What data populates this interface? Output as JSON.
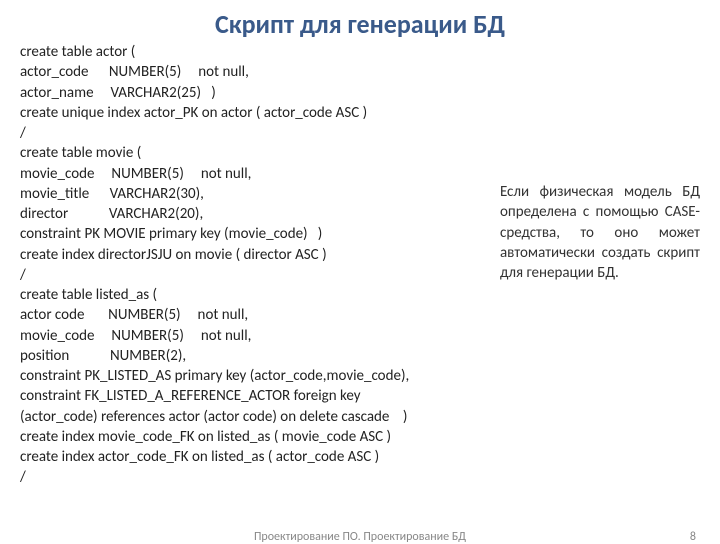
{
  "title": "Скрипт для генерации БД",
  "code": "create table actor (\nactor_code      NUMBER(5)     not null,\nactor_name     VARCHAR2(25)   )\ncreate unique index actor_PK on actor ( actor_code ASC )\n/\ncreate table movie (\nmovie_code     NUMBER(5)     not null,\nmovie_title      VARCHAR2(30),\ndirector            VARCHAR2(20),\nconstraint PK MOVIE primary key (movie_code)   )\ncreate index directorJSJU on movie ( director ASC )\n/\ncreate table listed_as (\nactor code       NUMBER(5)     not null,\nmovie_code     NUMBER(5)     not null,\nposition            NUMBER(2),\nconstraint PK_LISTED_AS primary key (actor_code,movie_code),\nconstraint FK_LISTED_A_REFERENCE_ACTOR foreign key\n(actor_code) references actor (actor code) on delete cascade    )\ncreate index movie_code_FK on listed_as ( movie_code ASC )\ncreate index actor_code_FK on listed_as ( actor_code ASC )\n/",
  "side_text": "Если физическая модель БД определена с помощью CASE-средства, то оно может автоматически создать скрипт для генерации БД.",
  "footer_center": "Проектирование ПО. Проектирование БД",
  "footer_page": "8"
}
